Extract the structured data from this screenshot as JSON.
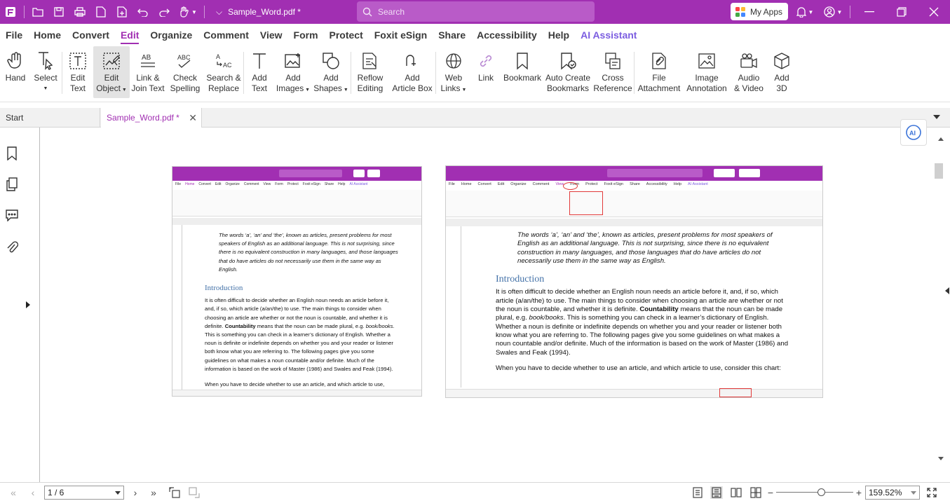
{
  "titlebar": {
    "doc_title": "Sample_Word.pdf *",
    "search_placeholder": "Search",
    "my_apps": "My Apps"
  },
  "menu": [
    "File",
    "Home",
    "Convert",
    "Edit",
    "Organize",
    "Comment",
    "View",
    "Form",
    "Protect",
    "Foxit eSign",
    "Share",
    "Accessibility",
    "Help",
    "AI Assistant"
  ],
  "ribbon": {
    "hand": "Hand",
    "select": "Select",
    "edit_text": [
      "Edit",
      "Text"
    ],
    "edit_object": [
      "Edit",
      "Object"
    ],
    "link_join": [
      "Link &",
      "Join Text"
    ],
    "check_spelling": [
      "Check",
      "Spelling"
    ],
    "search_replace": [
      "Search &",
      "Replace"
    ],
    "add_text": [
      "Add",
      "Text"
    ],
    "add_images": [
      "Add",
      "Images"
    ],
    "add_shapes": [
      "Add",
      "Shapes"
    ],
    "reflow": [
      "Reflow",
      "Editing"
    ],
    "add_article": [
      "Add",
      "Article Box"
    ],
    "web_links": [
      "Web",
      "Links"
    ],
    "link": "Link",
    "bookmark": "Bookmark",
    "auto_bookmarks": [
      "Auto Create",
      "Bookmarks"
    ],
    "cross_ref": [
      "Cross",
      "Reference"
    ],
    "file_attach": [
      "File",
      "Attachment"
    ],
    "image_annot": [
      "Image",
      "Annotation"
    ],
    "audio_video": [
      "Audio",
      "& Video"
    ],
    "add_3d": [
      "Add",
      "3D"
    ]
  },
  "tabs": {
    "start": "Start",
    "doc": "Sample_Word.pdf *"
  },
  "embedded": {
    "quote": "The words ‘a’, ‘an’ and ‘the’, known as articles, present problems for most speakers of English as an additional language. This is not surprising, since there is no equivalent construction in many languages, and those languages that do have articles do not necessarily use them in the same way as English.",
    "heading": "Introduction",
    "para1_pre": "It is often difficult to decide whether an English noun needs an article before it, and, if so, which article (a/an/the) to use. The main things to consider when choosing an article are whether or not the noun is countable, and whether it is definite.",
    "para1_bold": "Countability",
    "para1_mid": "means that the noun can be made plural, e.g.",
    "para1_ital": "book/books",
    "para1_post": ". This is something you can check in a learner’s dictionary of English. Whether a noun is definite or indefinite depends on whether you and your reader or listener both know what you are referring to. The following pages give you some guidelines on what makes a noun countable and/or definite. Much of the information is based on the work of Master (1986) and Swales and Feak (1994).",
    "para2": "When you have to decide whether to use an article, and which article to use, consider this chart:"
  },
  "status": {
    "page": "1 / 6",
    "zoom": "159.52%"
  }
}
